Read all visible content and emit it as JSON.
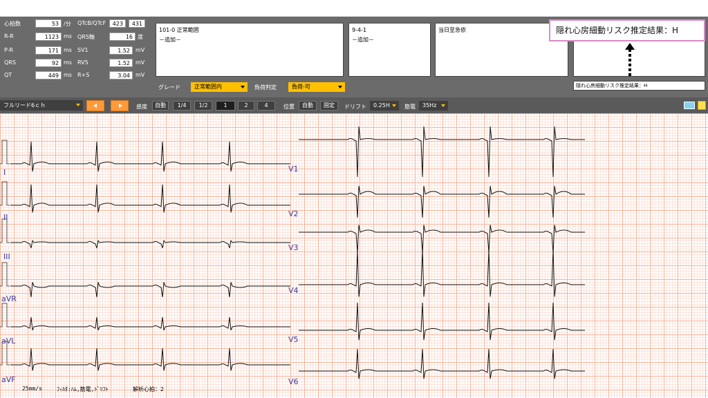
{
  "measurements": {
    "left": [
      {
        "label": "心拍数",
        "value": "53",
        "unit": "/分"
      },
      {
        "label": "R-R",
        "value": "1123",
        "unit": "ms"
      },
      {
        "label": "P-R",
        "value": "171",
        "unit": "ms"
      },
      {
        "label": "QRS",
        "value": "92",
        "unit": "ms"
      },
      {
        "label": "QT",
        "value": "449",
        "unit": "ms"
      }
    ],
    "right": [
      {
        "label": "QTcB/QTcF",
        "value": "423",
        "value2": "431",
        "unit": ""
      },
      {
        "label": "QRS軸",
        "value": "16",
        "unit": "度"
      },
      {
        "label": "SV1",
        "value": "1.52",
        "unit": "mV"
      },
      {
        "label": "RV5",
        "value": "1.52",
        "unit": "mV"
      },
      {
        "label": "R+S",
        "value": "3.04",
        "unit": "mV"
      }
    ]
  },
  "findings": {
    "line1": "101-0 正常範囲",
    "line2": "－追加－"
  },
  "codes": {
    "line1": "9-4-1",
    "line2": "－追加－"
  },
  "urgency": {
    "text": "当日至急依"
  },
  "risk": {
    "highlight": "隠れ心房細動リスク推定結果：H",
    "small": "隠れ心房細動リスク推定結果：H"
  },
  "grade": {
    "label": "グレード",
    "value": "正常範囲内"
  },
  "load": {
    "label": "負荷判定",
    "value": "負荷-可"
  },
  "toolbar": {
    "lead_mode": "フルリード6ｃｈ",
    "sensitivity_label": "感度",
    "sensitivity_options": [
      "自動",
      "1/4",
      "1/2",
      "1",
      "2",
      "4"
    ],
    "sensitivity_active": "1",
    "position_label": "位置",
    "position_options": [
      "自動",
      "固定"
    ],
    "drift_label": "ドリフト",
    "drift_value": "0.25H",
    "muscle_label": "筋電",
    "muscle_value": "35Hz"
  },
  "leads_left": [
    "I",
    "II",
    "III",
    "aVR",
    "aVL",
    "aVF"
  ],
  "leads_right": [
    "V1",
    "V2",
    "V3",
    "V4",
    "V5",
    "V6"
  ],
  "footer": {
    "speed": "25mm/s",
    "filter": "ﾌｨﾙﾀ:ﾊﾑ,筋電,ﾄﾞﾘﾌﾄ",
    "analysis": "解析心拍：2"
  },
  "colors": {
    "panel": "#6b6b6b",
    "toolbar": "#5a5a5a",
    "grade_select": "#ffc000",
    "nav_buttons": "#ff9a3c",
    "risk_border": "#d78bc8",
    "grid_major": "#f7b49a",
    "grid_minor": "#fde4da",
    "lead_label": "#3a3a9a"
  }
}
